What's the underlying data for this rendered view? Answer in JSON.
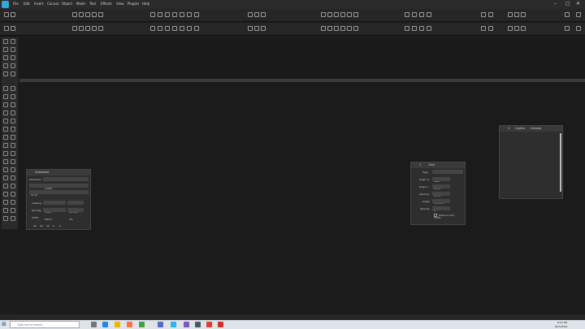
{
  "menu": {
    "items": [
      "File",
      "Edit",
      "Insert",
      "Canvas",
      "Object",
      "Mode",
      "Text",
      "Effects",
      "View",
      "Plugins",
      "Help"
    ]
  },
  "window_controls": {
    "minimize": "–",
    "maximize": "▢",
    "close": "✕"
  },
  "character_panel": {
    "tab": "Character",
    "character_label": "Character",
    "character_value": "Calibri",
    "font_size": "12 pt",
    "style_value": "Regular",
    "leading_label": "Leading",
    "leading_value": "Fixed",
    "leading_pt": "14.4 pt",
    "kerning_label": "Kerning",
    "kerning_value": "Metric",
    "kerning_num": "0%",
    "scale_pct": "100%",
    "aa_labels": [
      "AA",
      "Aa",
      "aa",
      "A",
      "A"
    ]
  },
  "grid_panel": {
    "tabs": [
      "1",
      "Grid"
    ],
    "type_label": "Type",
    "type_value": "Plain",
    "origin_x_label": "Origin X",
    "origin_x": "0.0 in",
    "origin_y_label": "Origin Y",
    "origin_y": "0.0 in",
    "spacing_label": "Spacing",
    "spacing": "0.125 in",
    "angle_label": "Angle",
    "angle": "0°",
    "opacity_label": "Opacity",
    "opacity": "100%",
    "snap_label": "Snap to Grid"
  },
  "canvas_panel": {
    "tabs": [
      "1",
      "Layers",
      "Canvas"
    ]
  },
  "taskbar": {
    "search_placeholder": "Type here to search",
    "time": "8:03 PM",
    "date": "8/15/2024"
  },
  "colors": {
    "accent": "#31a8d8",
    "panel_bg": "#2e2e2e",
    "canvas_bg": "#1b1b1b"
  }
}
